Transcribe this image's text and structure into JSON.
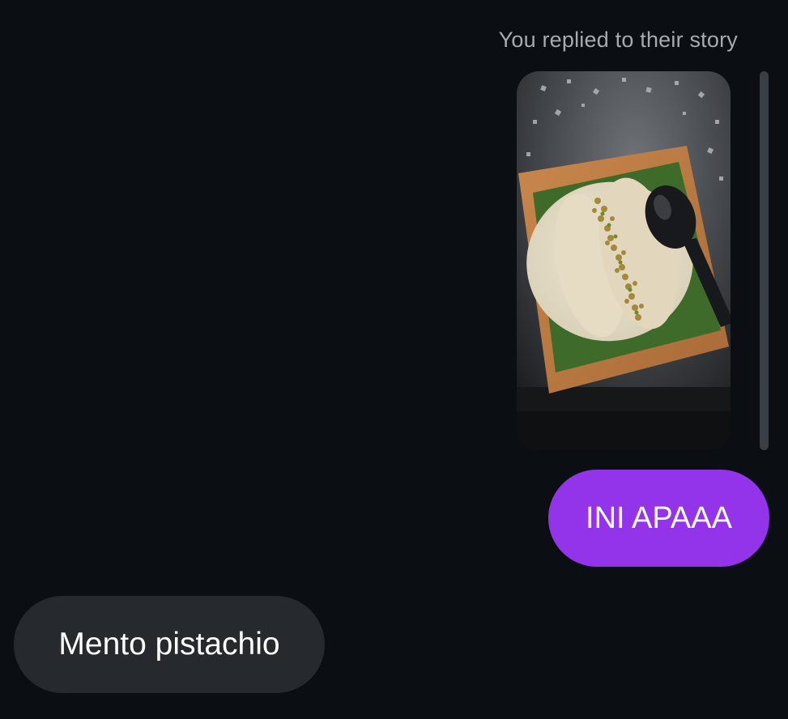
{
  "story_reply": {
    "caption": "You replied to their story"
  },
  "messages": [
    {
      "direction": "sent",
      "text": "INI APAAA"
    },
    {
      "direction": "received",
      "text": "Mento pistachio"
    }
  ],
  "colors": {
    "background": "#0b0f14",
    "sent_bubble": "#9333ea",
    "received_bubble": "#26292d",
    "caption_text": "#a7abb0"
  }
}
